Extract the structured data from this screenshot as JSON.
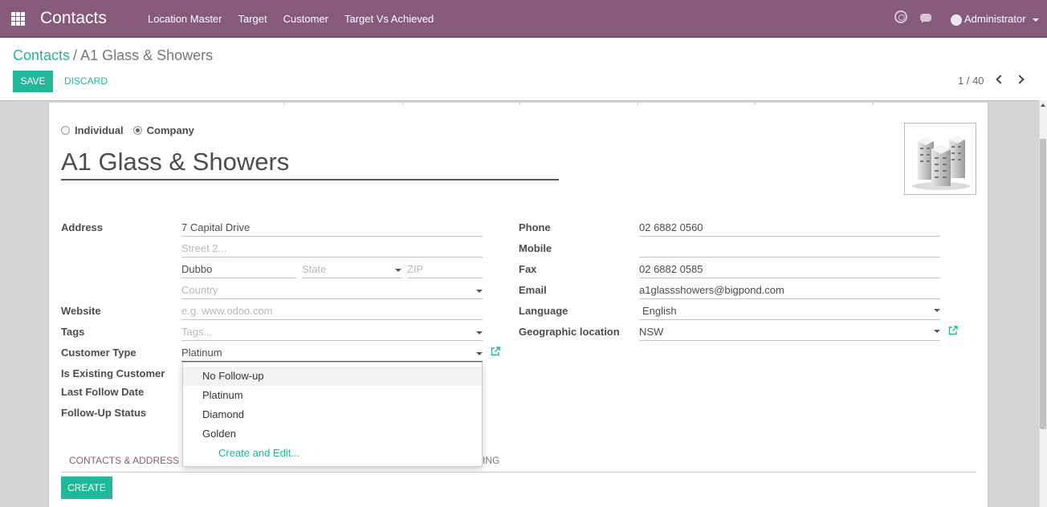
{
  "navbar": {
    "app_title": "Contacts",
    "menu": [
      "Location Master",
      "Target",
      "Customer",
      "Target Vs Achieved"
    ],
    "user": "Administrator",
    "color": "#875a7b"
  },
  "breadcrumb": {
    "parent": "Contacts",
    "separator": "/",
    "current": "A1 Glass & Showers"
  },
  "actions": {
    "save": "SAVE",
    "discard": "DISCARD"
  },
  "pager": {
    "text": "1 / 40"
  },
  "form": {
    "type_options": {
      "individual": "Individual",
      "company": "Company",
      "selected": "Company"
    },
    "name": "A1 Glass & Showers",
    "left": {
      "address_label": "Address",
      "street": "7 Capital Drive",
      "street2_placeholder": "Street 2...",
      "city": "Dubbo",
      "state_placeholder": "State",
      "zip_placeholder": "ZIP",
      "country_placeholder": "Country",
      "website_label": "Website",
      "website_placeholder": "e.g. www.odoo.com",
      "tags_label": "Tags",
      "tags_placeholder": "Tags...",
      "customer_type_label": "Customer Type",
      "customer_type_value": "Platinum",
      "is_existing_label": "Is Existing Customer",
      "last_follow_label": "Last Follow Date",
      "follow_status_label": "Follow-Up Status"
    },
    "right": {
      "phone_label": "Phone",
      "phone": "02 6882 0560",
      "mobile_label": "Mobile",
      "mobile": "",
      "fax_label": "Fax",
      "fax": "02 6882 0585",
      "email_label": "Email",
      "email": "a1glassshowers@bigpond.com",
      "language_label": "Language",
      "language": "English",
      "geo_label": "Geographic location",
      "geo": "NSW"
    }
  },
  "dropdown": {
    "items": [
      "No Follow-up",
      "Platinum",
      "Diamond",
      "Golden"
    ],
    "create": "Create and Edit..."
  },
  "tabs": {
    "active": "CONTACTS & ADDRESS",
    "partial": "ING"
  },
  "create_button": "CREATE",
  "accent": "#21b799"
}
